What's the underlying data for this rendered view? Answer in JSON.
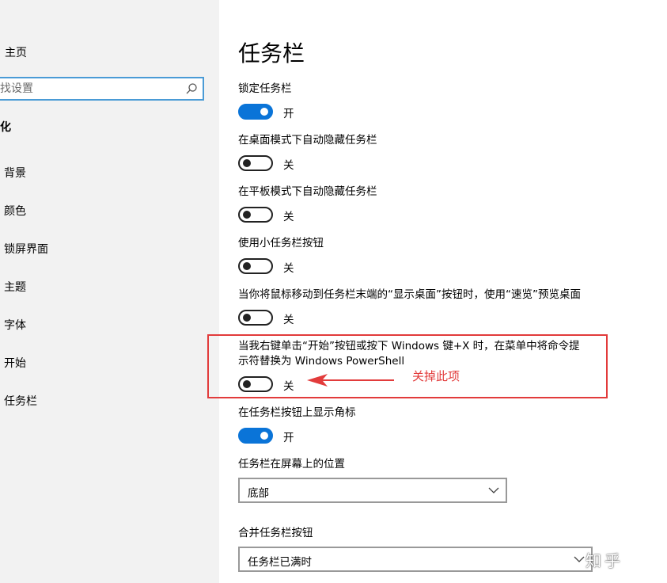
{
  "sidebar": {
    "home": "主页",
    "search_placeholder": "找设置",
    "section_title": "化",
    "items": [
      {
        "label": "背景"
      },
      {
        "label": "颜色"
      },
      {
        "label": "锁屏界面"
      },
      {
        "label": "主题"
      },
      {
        "label": "字体"
      },
      {
        "label": "开始"
      },
      {
        "label": "任务栏"
      }
    ]
  },
  "main": {
    "title": "任务栏",
    "settings": [
      {
        "label": "锁定任务栏",
        "state": "开",
        "on": true
      },
      {
        "label": "在桌面模式下自动隐藏任务栏",
        "state": "关",
        "on": false
      },
      {
        "label": "在平板模式下自动隐藏任务栏",
        "state": "关",
        "on": false
      },
      {
        "label": "使用小任务栏按钮",
        "state": "关",
        "on": false
      },
      {
        "label": "当你将鼠标移动到任务栏末端的“显示桌面”按钮时，使用“速览”预览桌面",
        "state": "关",
        "on": false
      },
      {
        "label_line1": "当我右键单击“开始”按钮或按下 Windows 键+X 时，在菜单中将命令提",
        "label_line2": "示符替换为 Windows PowerShell",
        "state": "关",
        "on": false
      },
      {
        "label": "在任务栏按钮上显示角标",
        "state": "开",
        "on": true
      }
    ],
    "position_label": "任务栏在屏幕上的位置",
    "position_value": "底部",
    "combine_label": "合并任务栏按钮",
    "combine_value": "任务栏已满时"
  },
  "annotation": {
    "text": "关掉此项",
    "color": "#e23b3b"
  },
  "watermark": "知乎",
  "colors": {
    "accent": "#0a74d8",
    "sidebar_bg": "#f2f2f2"
  }
}
